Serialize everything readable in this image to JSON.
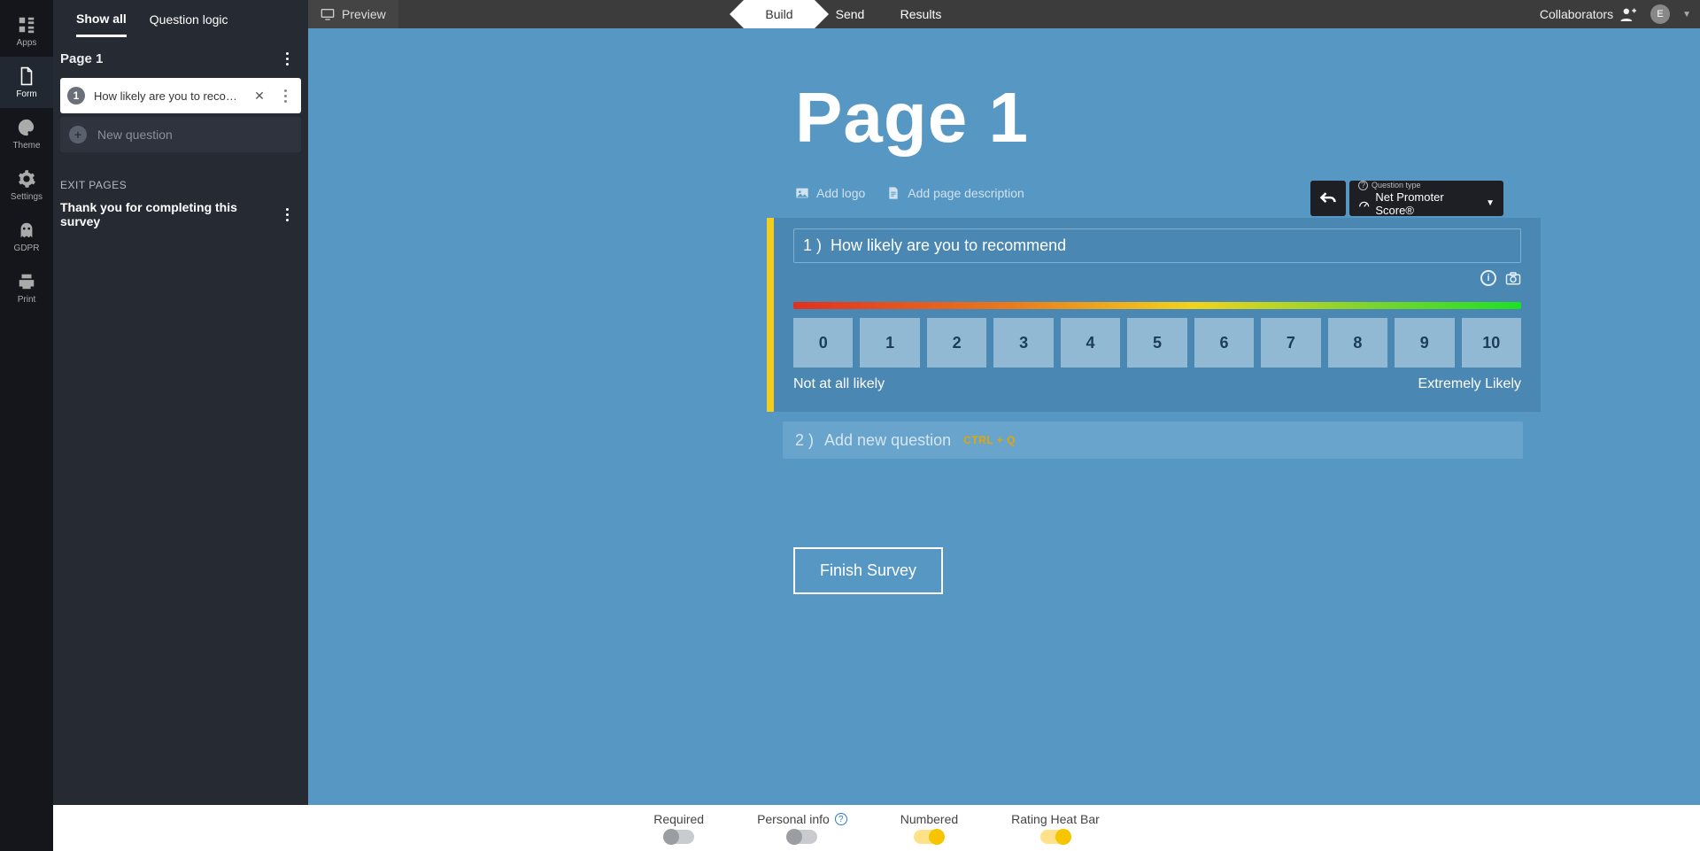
{
  "topbar": {
    "preview": "Preview",
    "stages": {
      "build": "Build",
      "send": "Send",
      "results": "Results"
    },
    "collaborators": "Collaborators",
    "avatar_initial": "E"
  },
  "rail": {
    "apps": "Apps",
    "form": "Form",
    "theme": "Theme",
    "settings": "Settings",
    "gdpr": "GDPR",
    "print": "Print"
  },
  "sidebar": {
    "tabs": {
      "show_all": "Show all",
      "question_logic": "Question logic"
    },
    "page_label": "Page 1",
    "q1": {
      "num": "1",
      "text": "How likely are you to recommen"
    },
    "new_question": "New question",
    "exit_header": "EXIT PAGES",
    "exit_item": "Thank you for completing this survey"
  },
  "canvas": {
    "title": "Page 1",
    "add_logo": "Add logo",
    "add_desc": "Add page description",
    "qtype_label": "Question type",
    "qtype_value": "Net Promoter Score®",
    "q_prefix": "1 )  ",
    "q_text": "How likely are you to recommend",
    "nps": [
      "0",
      "1",
      "2",
      "3",
      "4",
      "5",
      "6",
      "7",
      "8",
      "9",
      "10"
    ],
    "anchor_low": "Not at all likely",
    "anchor_high": "Extremely Likely",
    "addq_prefix": "2 )  ",
    "addq_text": "Add new question",
    "addq_hint": "CTRL + Q",
    "finish": "Finish Survey"
  },
  "footer": {
    "required": "Required",
    "personal": "Personal info",
    "numbered": "Numbered",
    "heatbar": "Rating Heat Bar"
  }
}
